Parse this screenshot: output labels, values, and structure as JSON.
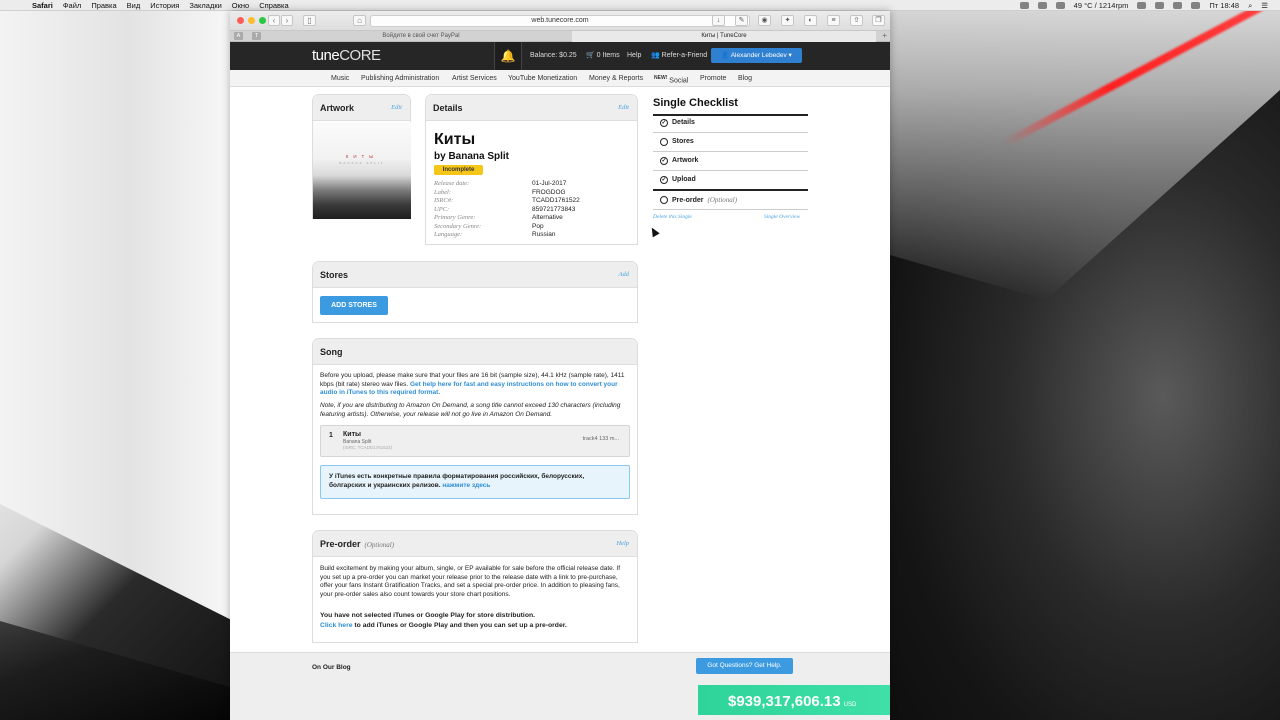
{
  "menubar": {
    "app": "Safari",
    "items": [
      "Файл",
      "Правка",
      "Вид",
      "История",
      "Закладки",
      "Окно",
      "Справка"
    ],
    "weather": "49 °C / 1214rpm",
    "clock": "Пт 18:48"
  },
  "browser": {
    "url": "web.tunecore.com",
    "pinned": [
      "A",
      "T"
    ],
    "tabs": [
      {
        "label": "Войдите в свой счет PayPal",
        "active": false
      },
      {
        "label": "Киты | TuneCore",
        "active": true
      }
    ]
  },
  "header": {
    "logo_tune": "tune",
    "logo_core": "CORE",
    "bell": "🔔",
    "balance": "Balance: $0.25",
    "cart": "0 Items",
    "help": "Help",
    "refer": "Refer-a-Friend",
    "user": "Alexander Lebedev"
  },
  "subnav": {
    "items": [
      "Music",
      "Publishing Administration",
      "Artist Services",
      "YouTube Monetization",
      "Money & Reports",
      "Social",
      "Promote",
      "Blog"
    ],
    "new_label": "NEW!"
  },
  "artwork": {
    "title": "Artwork",
    "edit": "Edit",
    "cover_title": "КИТЫ",
    "cover_sub": "BANANA SPLIT"
  },
  "details": {
    "title": "Details",
    "edit": "Edit",
    "album_title": "Киты",
    "artist": "by Banana Split",
    "status": "Incomplete",
    "rows": [
      {
        "k": "Release date:",
        "v": "01-Jul-2017"
      },
      {
        "k": "Label:",
        "v": "FROGDOG"
      },
      {
        "k": "ISRC#:",
        "v": "TCADD1761522"
      },
      {
        "k": "UPC:",
        "v": "859721773843"
      },
      {
        "k": "Primary Genre:",
        "v": "Alternative"
      },
      {
        "k": "Secondary Genre:",
        "v": "Pop"
      },
      {
        "k": "Language:",
        "v": "Russian"
      }
    ]
  },
  "checklist": {
    "title": "Single Checklist",
    "items": [
      {
        "label": "Details",
        "done": true
      },
      {
        "label": "Stores",
        "done": false
      },
      {
        "label": "Artwork",
        "done": true
      },
      {
        "label": "Upload",
        "done": true
      }
    ],
    "preorder": {
      "label": "Pre-order",
      "optional": "(Optional)"
    },
    "delete_link": "Delete this Single",
    "overview_link": "Single Overview"
  },
  "stores": {
    "title": "Stores",
    "add": "Add",
    "button": "ADD STORES"
  },
  "song": {
    "title": "Song",
    "para1": "Before you upload, please make sure that your files are 16 bit (sample size), 44.1 kHz (sample rate), 1411 kbps (bit rate) stereo wav files.",
    "para1_link": "Get help here for fast and easy instructions on how to convert your audio in iTunes to this required format.",
    "para2": "Note, if you are distributing to Amazon On Demand, a song title cannot exceed 130 characters (including featuring artists). Otherwise, your release will not go live in Amazon On Demand.",
    "track": {
      "num": "1",
      "title": "Киты",
      "artist": "Banana Split",
      "isrc": "(ISRC: TCADD1761522)",
      "file": "track4 133 m..."
    },
    "notice": "У iTunes есть конкретные правила форматирования российских, белорусских, болгарских и украинских релизов.",
    "notice_link": "нажмите здесь"
  },
  "preorder": {
    "title": "Pre-order",
    "optional": "(Optional)",
    "help": "Help",
    "para": "Build excitement by making your album, single, or EP available for sale before the official release date. If you set up a pre-order you can market your release prior to the release date with a link to pre-purchase, offer your fans Instant Gratification Tracks, and set a special pre-order price. In addition to pleasing fans, your pre-order sales also count towards your store chart positions.",
    "warn": "You have not selected iTunes or Google Play for store distribution.",
    "warn_link": "Click here",
    "warn_rest": "to add iTunes or Google Play and then you can set up a pre-order."
  },
  "footer": {
    "blog": "On Our Blog",
    "help_button": "Got Questions? Get Help.",
    "earnings": "$939,317,606.13",
    "earnings_unit": "USD"
  }
}
